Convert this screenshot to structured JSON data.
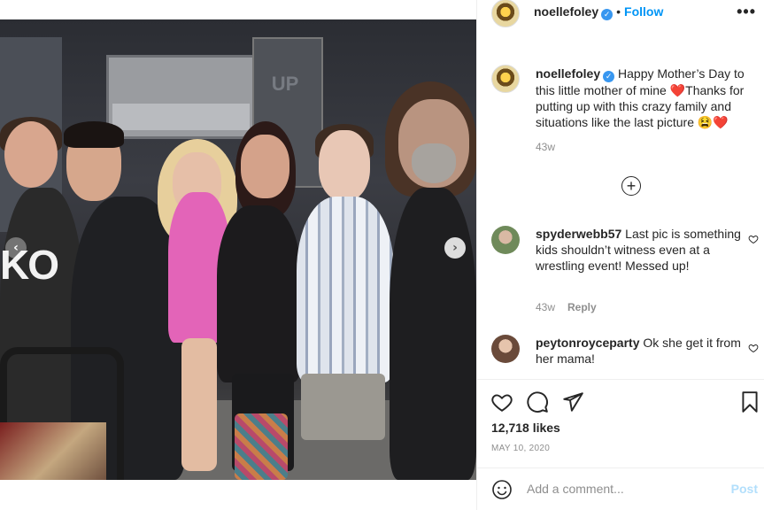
{
  "post": {
    "author": "noellefoley",
    "follow_label": "Follow",
    "separator": "•",
    "more_label": "•••",
    "caption": "Happy Mother’s Day to this little mother of mine ❤️Thanks for putting up with this crazy family and situations like the last picture 😫❤️",
    "caption_time": "43w",
    "photo_shirt_text": "KO",
    "photo_case_text": "UP"
  },
  "comments": [
    {
      "username": "spyderwebb57",
      "text": "Last pic is something kids shouldn’t witness even at a wrestling event! Messed up!",
      "time": "43w",
      "reply_label": "Reply"
    },
    {
      "username": "peytonroyceparty",
      "text": "Ok she get it from her mama!"
    }
  ],
  "stats": {
    "likes": "12,718 likes",
    "date": "MAY 10, 2020"
  },
  "composer": {
    "placeholder": "Add a comment...",
    "post_label": "Post"
  },
  "icons": {
    "verified": "verified-badge-icon",
    "like": "heart-icon",
    "comment": "comment-bubble-icon",
    "share": "paper-plane-icon",
    "save": "bookmark-icon",
    "emoji": "smiley-icon",
    "load_more": "plus-circle-icon",
    "carousel_prev": "chevron-left-icon",
    "carousel_next": "chevron-right-icon"
  },
  "colors": {
    "accent": "#0095f6",
    "verified": "#3897f0",
    "muted": "#8e8e8e",
    "post_disabled": "#b2dffc"
  }
}
